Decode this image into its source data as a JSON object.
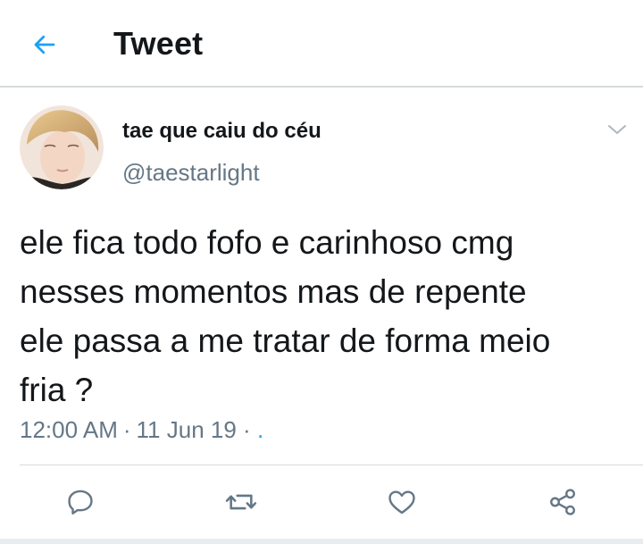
{
  "header": {
    "title": "Tweet",
    "back_icon": "arrow-left-icon"
  },
  "tweet": {
    "author": {
      "name": "tae que caiu do céu",
      "handle": "@taestarlight",
      "avatar": "profile-photo"
    },
    "menu_icon": "chevron-down-icon",
    "text": "ele fica todo fofo e carinhoso cmg\nnesses momentos mas de repente\nele passa a me tratar de forma meio\nfria ?",
    "time": "12:00 AM",
    "date": "11 Jun 19",
    "trailing_dots": ". ."
  },
  "actions": {
    "reply_icon": "reply-icon",
    "retweet_icon": "retweet-icon",
    "like_icon": "heart-icon",
    "share_icon": "share-icon"
  },
  "colors": {
    "accent": "#1da1f2",
    "text_primary": "#14171a",
    "text_secondary": "#657786",
    "icon_gray": "#657786",
    "divider": "#d7dbde"
  }
}
